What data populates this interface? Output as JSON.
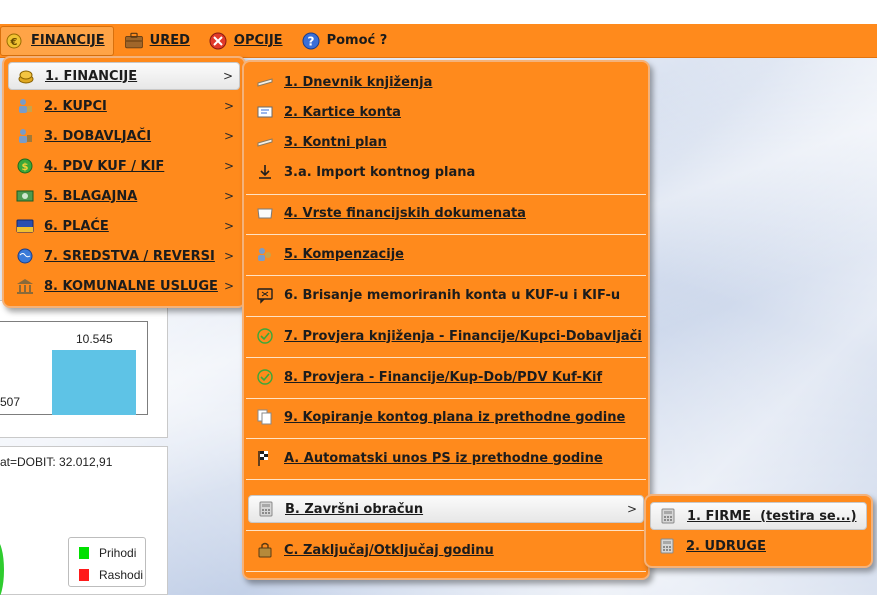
{
  "menubar": {
    "items": [
      {
        "label": "FINANCIJE",
        "icon": "money-icon"
      },
      {
        "label": "URED",
        "icon": "briefcase-icon"
      },
      {
        "label": "OPCIJE",
        "icon": "options-icon"
      },
      {
        "label": "Pomoć ?",
        "icon": "help-icon"
      }
    ]
  },
  "menu_main": {
    "items": [
      {
        "label": "1. FINANCIJE",
        "icon": "coins-icon"
      },
      {
        "label": "2. KUPCI",
        "icon": "customers-icon"
      },
      {
        "label": "3. DOBAVLJAČI",
        "icon": "suppliers-icon"
      },
      {
        "label": "4. PDV KUF / KIF",
        "icon": "tax-icon"
      },
      {
        "label": "5. BLAGAJNA",
        "icon": "cash-icon"
      },
      {
        "label": "6. PLAĆE",
        "icon": "card-icon"
      },
      {
        "label": "7. SREDSTVA / REVERSI",
        "icon": "globe-icon"
      },
      {
        "label": "8. KOMUNALNE USLUGE",
        "icon": "building-icon"
      }
    ]
  },
  "menu_fin": {
    "items": [
      {
        "label": "1. Dnevnik knjiženja",
        "icon": "journal-icon"
      },
      {
        "label": "2. Kartice konta",
        "icon": "card-file-icon"
      },
      {
        "label": "3. Kontni plan",
        "icon": "plan-icon"
      },
      {
        "label": "3.a. Import kontnog plana",
        "icon": "download-icon"
      },
      {
        "label": "4. Vrste financijskih dokumenata",
        "icon": "folder-icon"
      },
      {
        "label": "5. Kompenzacije",
        "icon": "compensation-icon"
      },
      {
        "label": "6. Brisanje memoriranih konta u KUF-u i KIF-u",
        "icon": "delete-icon"
      },
      {
        "label": "7. Provjera knjiženja - Financije/Kupci-Dobavljači",
        "icon": "check-icon"
      },
      {
        "label": "8. Provjera - Financije/Kup-Dob/PDV Kuf-Kif",
        "icon": "check-icon"
      },
      {
        "label": "9. Kopiranje kontog plana iz prethodne godine",
        "icon": "copy-icon"
      },
      {
        "label": "A. Automatski unos PS iz prethodne godine",
        "icon": "flag-icon"
      },
      {
        "label": "B. Završni obračun",
        "icon": "calculator-icon"
      },
      {
        "label": "C. Zaključaj/Otključaj godinu",
        "icon": "lock-icon"
      }
    ]
  },
  "menu_zavrsni": {
    "items": [
      {
        "label": "1. FIRME  (testira se...)",
        "icon": "calculator-icon"
      },
      {
        "label": "2. UDRUGE",
        "icon": "calculator-icon"
      }
    ]
  },
  "chart_panel": {
    "value_main": "10.545",
    "value_left": "507",
    "dobit_text": "at=DOBIT: 32.012,91",
    "legend": [
      {
        "label": "Prihodi",
        "color": "#00e000"
      },
      {
        "label": "Rashodi",
        "color": "#ff1a1a"
      }
    ]
  },
  "colors": {
    "menu_orange": "#ff8a1c",
    "bar_blue": "#5ec3e6"
  }
}
